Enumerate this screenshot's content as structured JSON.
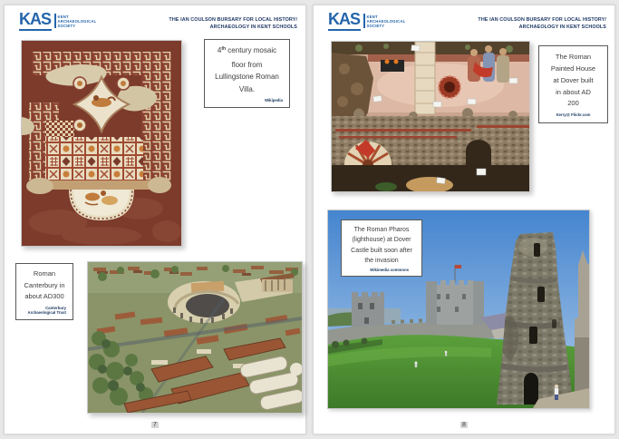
{
  "pages": [
    {
      "number": "7",
      "logo": {
        "acronym": "KAS",
        "org_lines": [
          "KENT",
          "ARCHAEOLOGICAL",
          "SOCIETY"
        ]
      },
      "header": {
        "line1": "THE IAN COULSON BURSARY FOR LOCAL HISTORY/",
        "line2": "ARCHAEOLOGY IN KENT SCHOOLS"
      },
      "captions": [
        {
          "l1_pre": "4",
          "l1_sup": "th",
          "l1_rest": " century mosaic",
          "lines": [
            "floor from",
            "Lullingstone Roman",
            "Villa."
          ],
          "attribution": "Wikipedia"
        },
        {
          "lines": [
            "Roman",
            "Canterbury in",
            "about AD300"
          ],
          "attribution_lines": [
            "Canterbury",
            "Archaeological Trust"
          ]
        }
      ]
    },
    {
      "number": "8",
      "logo": {
        "acronym": "KAS",
        "org_lines": [
          "KENT",
          "ARCHAEOLOGICAL",
          "SOCIETY"
        ]
      },
      "header": {
        "line1": "THE IAN COULSON BURSARY FOR LOCAL HISTORY/",
        "line2": "ARCHAEOLOGY IN KENT SCHOOLS"
      },
      "captions": [
        {
          "lines": [
            "The Roman",
            "Painted House",
            "at Dover built",
            "in about AD",
            "200"
          ],
          "attribution": "Kerry@ Flickr.com"
        },
        {
          "lines": [
            "The Roman Pharos",
            "(lighthouse) at Dover",
            "Castle built soon after",
            "the invasion"
          ],
          "attribution": "Wikimedia commons"
        }
      ]
    }
  ],
  "colors": {
    "logo_blue": "#2465ab",
    "header_navy": "#1f3864",
    "attribution_navy": "#17375e",
    "page_background": "#ffffff",
    "app_background": "#e8e8e8"
  }
}
